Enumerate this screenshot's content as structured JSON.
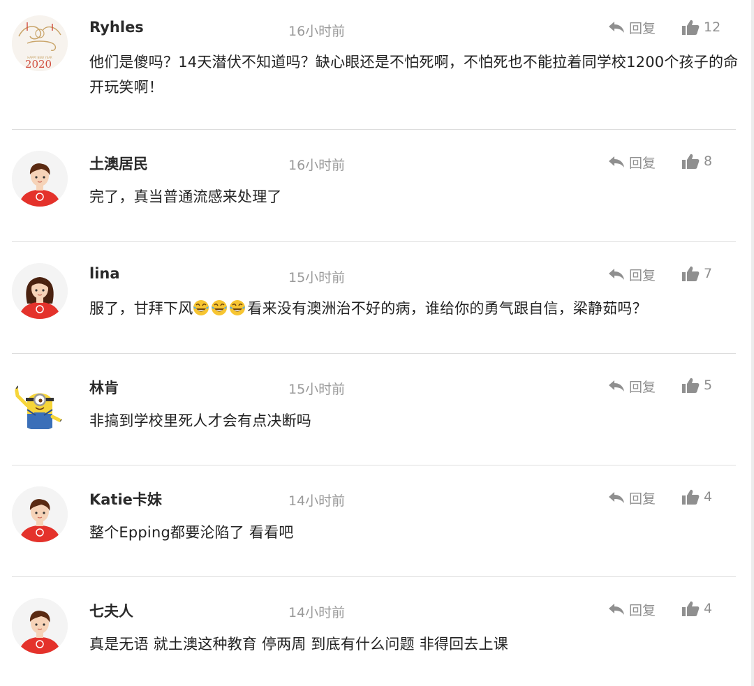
{
  "ui": {
    "reply_label": "回复"
  },
  "comments": [
    {
      "username": "Ryhles",
      "time": "16小时前",
      "likes": "12",
      "text": "他们是傻吗？14天潜伏不知道吗？缺心眼还是不怕死啊，不怕死也不能拉着同学校1200个孩子的命开玩笑啊！",
      "avatar": "new-year-2020-avatar",
      "avatar_text": "2020",
      "avatar_subtext": "HAPPY NEW YEAR"
    },
    {
      "username": "土澳居民",
      "time": "16小时前",
      "likes": "8",
      "text": "完了，真当普通流感来处理了",
      "avatar": "default-boy-avatar"
    },
    {
      "username": "lina",
      "time": "15小时前",
      "likes": "7",
      "text_before": "服了，甘拜下风",
      "text_after": "看来没有澳洲治不好的病，谁给你的勇气跟自信，梁静茹吗？",
      "emoji": "tears-of-joy-emoji",
      "avatar": "default-girl-avatar"
    },
    {
      "username": "林肯",
      "time": "15小时前",
      "likes": "5",
      "text": "非搞到学校里死人才会有点决断吗",
      "avatar": "minion-avatar"
    },
    {
      "username": "Katie卡妹",
      "time": "14小时前",
      "likes": "4",
      "text": "整个Epping都要沦陷了 看看吧",
      "avatar": "default-boy-avatar"
    },
    {
      "username": "七夫人",
      "time": "14小时前",
      "likes": "4",
      "text": "真是无语 就土澳这种教育 停两周 到底有什么问题 非得回去上课",
      "avatar": "default-boy-avatar"
    }
  ],
  "colors": {
    "divider": "#dddddd",
    "meta_gray": "#9a9a9a",
    "avatar_shirt_red": "#e4322b",
    "hair": "#5a2a12"
  }
}
